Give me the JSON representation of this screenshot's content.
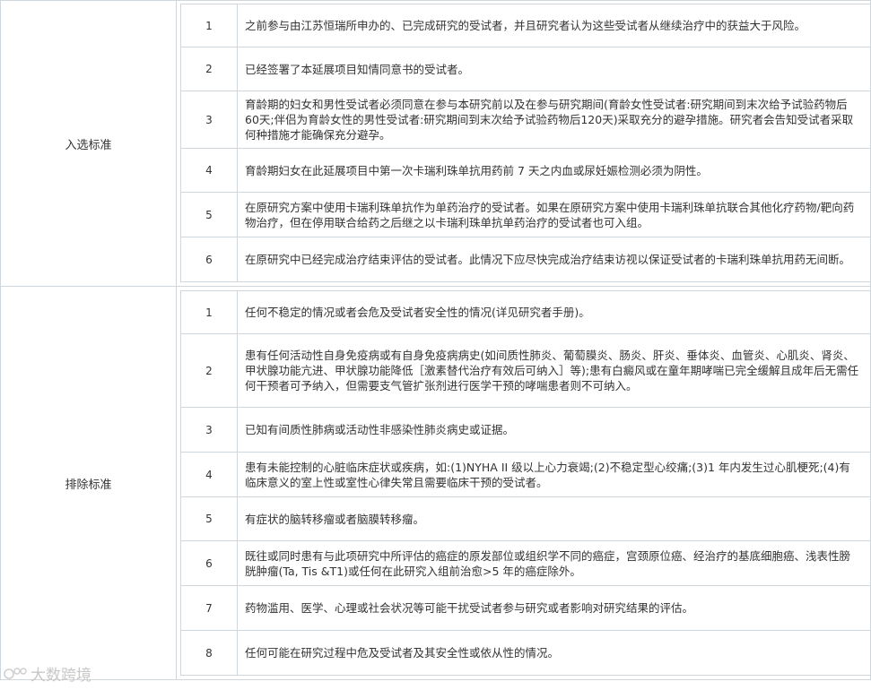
{
  "sections": [
    {
      "label": "入选标准",
      "rows": [
        {
          "num": "1",
          "text": "之前参与由江苏恒瑞所申办的、已完成研究的受试者，并且研究者认为这些受试者从继续治疗中的获益大于风险。"
        },
        {
          "num": "2",
          "text": "已经签署了本延展项目知情同意书的受试者。"
        },
        {
          "num": "3",
          "text": "育龄期的妇女和男性受试者必须同意在参与本研究前以及在参与研究期间(育龄女性受试者:研究期间到末次给予试验药物后60天;伴侣为育龄女性的男性受试者:研究期间到末次给予试验药物后120天)采取充分的避孕措施。研究者会告知受试者采取何种措施才能确保充分避孕。"
        },
        {
          "num": "4",
          "text": "育龄期妇女在此延展项目中第一次卡瑞利珠单抗用药前 7 天之内血或尿妊娠检测必须为阴性。"
        },
        {
          "num": "5",
          "text": "在原研究方案中使用卡瑞利珠单抗作为单药治疗的受试者。如果在原研究方案中使用卡瑞利珠单抗联合其他化疗药物/靶向药物治疗，但在停用联合给药之后继之以卡瑞利珠单抗单药治疗的受试者也可入组。"
        },
        {
          "num": "6",
          "text": "在原研究中已经完成治疗结束评估的受试者。此情况下应尽快完成治疗结束访视以保证受试者的卡瑞利珠单抗用药无间断。"
        }
      ]
    },
    {
      "label": "排除标准",
      "rows": [
        {
          "num": "1",
          "text": "任何不稳定的情况或者会危及受试者安全性的情况(详见研究者手册)。"
        },
        {
          "num": "2",
          "text": "患有任何活动性自身免疫病或有自身免疫病病史(如间质性肺炎、葡萄膜炎、肠炎、肝炎、垂体炎、血管炎、心肌炎、肾炎、甲状腺功能亢进、甲状腺功能降低［激素替代治疗有效后可纳入］等);患有白癜风或在童年期哮喘已完全缓解且成年后无需任何干预者可予纳入，但需要支气管扩张剂进行医学干预的哮喘患者则不可纳入。"
        },
        {
          "num": "3",
          "text": "已知有间质性肺病或活动性非感染性肺炎病史或证据。"
        },
        {
          "num": "4",
          "text": "患有未能控制的心脏临床症状或疾病，如:(1)NYHA II 级以上心力衰竭;(2)不稳定型心绞痛;(3)1 年内发生过心肌梗死;(4)有临床意义的室上性或室性心律失常且需要临床干预的受试者。"
        },
        {
          "num": "5",
          "text": "有症状的脑转移瘤或者脑膜转移瘤。"
        },
        {
          "num": "6",
          "text": "既往或同时患有与此项研究中所评估的癌症的原发部位或组织学不同的癌症，宫颈原位癌、经治疗的基底细胞癌、浅表性膀胱肿瘤(Ta, Tis &T1)或任何在此研究入组前治愈>5 年的癌症除外。"
        },
        {
          "num": "7",
          "text": "药物滥用、医学、心理或社会状况等可能干扰受试者参与研究或者影响对研究结果的评估。"
        },
        {
          "num": "8",
          "text": "任何可能在研究过程中危及受试者及其安全性或依从性的情况。"
        }
      ]
    }
  ],
  "watermark": "大数跨境"
}
